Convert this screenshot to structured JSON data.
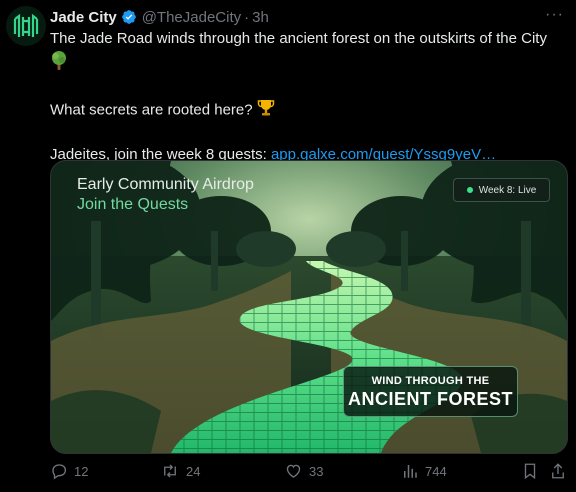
{
  "post": {
    "author_name": "Jade City",
    "handle": "@TheJadeCity",
    "separator": "·",
    "time": "3h",
    "more": "···",
    "line1": "The Jade Road winds through the ancient forest on the outskirts of the City",
    "line1_emoji": "deciduous-tree",
    "line2": "What secrets are rooted here?",
    "line2_emoji": "trophy",
    "line3_prefix": "Jadeites, join the week 8 quests: ",
    "link": "app.galxe.com/quest/Yssg9yeV…"
  },
  "media": {
    "overlay_title": "Early Community Airdrop",
    "overlay_subtitle": "Join the Quests",
    "badge": "Week 8: Live",
    "caption_line1": "WIND THROUGH THE",
    "caption_line2": "ANCIENT FOREST"
  },
  "actions": {
    "replies": "12",
    "reposts": "24",
    "likes": "33",
    "views": "744"
  },
  "colors": {
    "link": "#1d9bf0",
    "muted": "#71767b",
    "accent": "#3ce38a",
    "verified": "#1d9bf0"
  }
}
